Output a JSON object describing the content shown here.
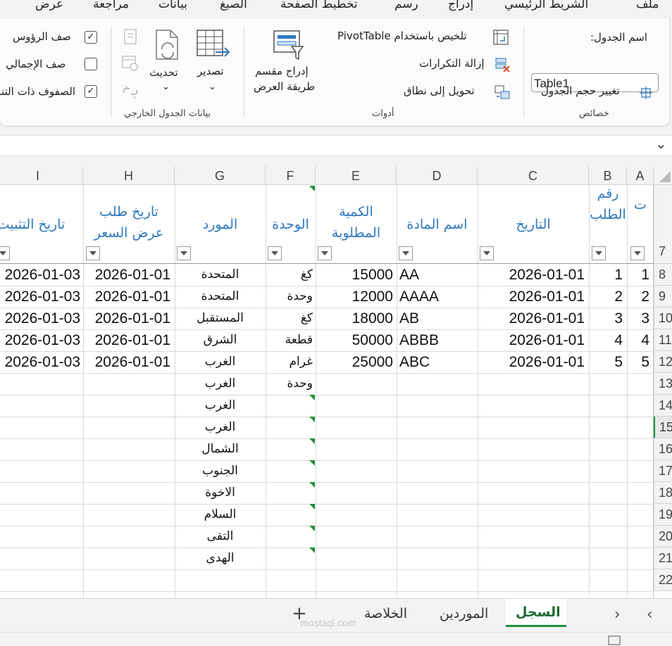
{
  "menu_tabs": [
    "ملف",
    "الشريط الرئيسي",
    "إدراج",
    "رسم",
    "تخطيط الصفحة",
    "الصيغ",
    "بيانات",
    "مراجعة",
    "عرض"
  ],
  "ribbon": {
    "properties": {
      "table_name_label": "اسم الجدول:",
      "table_name_value": "Table1",
      "resize_label": "تغيير حجم الجدول",
      "group_title": "خصائص"
    },
    "tools": {
      "pivot_label": "تلخيص باستخدام PivotTable",
      "remove_dup_label": "إزالة التكرارات",
      "convert_label": "تحويل إلى نطاق",
      "slicer_line1": "إدراج مقسم",
      "slicer_line2": "طريقة العرض",
      "group_title": "أدوات"
    },
    "external": {
      "export_label": "تصدير",
      "refresh_label": "تحديث",
      "group_title": "بيانات الجدول الخارجي"
    },
    "style_options": {
      "header_row": "صف الرؤوس",
      "total_row": "صف الإجمالي",
      "banded_rows": "الصفوف ذات التنسيق"
    }
  },
  "grid": {
    "columns": [
      "A",
      "B",
      "C",
      "D",
      "E",
      "F",
      "G",
      "H",
      "I"
    ],
    "row_numbers": [
      "7",
      "8",
      "9",
      "10",
      "11",
      "12",
      "13",
      "14",
      "15",
      "16",
      "17",
      "18",
      "19",
      "20",
      "21",
      "22"
    ],
    "headers": {
      "A": "ت",
      "B": "رقم الطلب",
      "C": "التاريخ",
      "D": "اسم المادة",
      "E": "الكمية المطلوبة",
      "F": "الوحدة",
      "G": "المورد",
      "H": "تاريخ طلب عرض السعر",
      "I": "تاريخ التثبيت"
    },
    "rows": [
      {
        "a": "1",
        "b": "1",
        "c": "2026-01-01",
        "d": "AA",
        "e": "15000",
        "f": "كغ",
        "g": "المتحدة",
        "h": "2026-01-01",
        "i": "2026-01-03"
      },
      {
        "a": "2",
        "b": "2",
        "c": "2026-01-01",
        "d": "AAAA",
        "e": "12000",
        "f": "وحدة",
        "g": "المتحدة",
        "h": "2026-01-01",
        "i": "2026-01-03"
      },
      {
        "a": "3",
        "b": "3",
        "c": "2026-01-01",
        "d": "AB",
        "e": "18000",
        "f": "كغ",
        "g": "المستقبل",
        "h": "2026-01-01",
        "i": "2026-01-03"
      },
      {
        "a": "4",
        "b": "4",
        "c": "2026-01-01",
        "d": "ABBB",
        "e": "50000",
        "f": "قطعة",
        "g": "الشرق",
        "h": "2026-01-01",
        "i": "2026-01-03"
      },
      {
        "a": "5",
        "b": "5",
        "c": "2026-01-01",
        "d": "ABC",
        "e": "25000",
        "f": "غرام",
        "g": "الغرب",
        "h": "2026-01-01",
        "i": "2026-01-03"
      }
    ],
    "extra_g": [
      "الغرب",
      "الغرب",
      "الغرب",
      "الشمال",
      "الجنوب",
      "الاخوة",
      "السلام",
      "التقى",
      "الهدى"
    ],
    "extra_f": [
      "وحدة"
    ]
  },
  "sheet_tabs": {
    "tabs": [
      "السجل",
      "الموردين",
      "الخلاصة"
    ],
    "active": "السجل",
    "add": "+"
  },
  "watermark": "mostaql.com"
}
